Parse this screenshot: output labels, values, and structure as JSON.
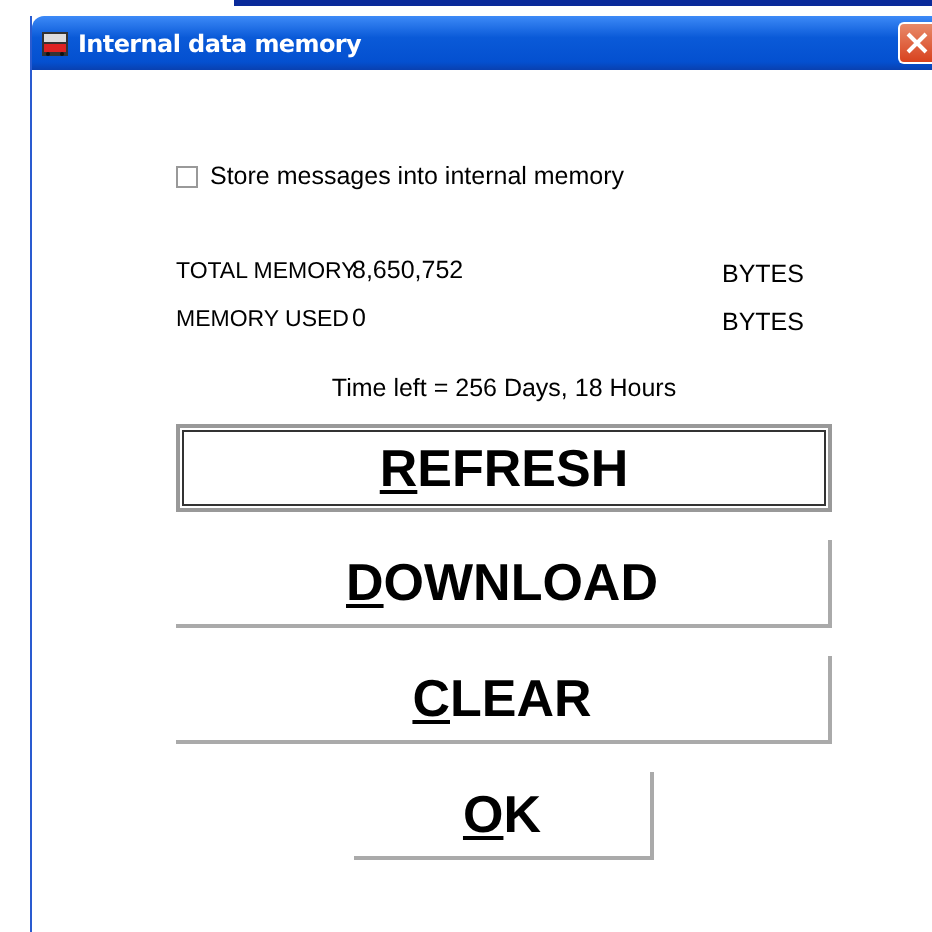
{
  "window": {
    "title": "Internal data memory"
  },
  "store_messages": {
    "label": "Store messages into internal memory",
    "checked": false
  },
  "memory_rows": [
    {
      "label": "TOTAL MEMORY",
      "value": "8,650,752",
      "unit": "BYTES"
    },
    {
      "label": "MEMORY USED",
      "value": "0",
      "unit": "BYTES"
    }
  ],
  "time_left": "Time left = 256 Days, 18 Hours",
  "buttons": [
    {
      "label": "REFRESH",
      "default": true,
      "kind": "wide"
    },
    {
      "label": "DOWNLOAD",
      "default": false,
      "kind": "wide"
    },
    {
      "label": "CLEAR",
      "default": false,
      "kind": "wide"
    },
    {
      "label": "OK",
      "default": false,
      "kind": "narrow"
    }
  ]
}
